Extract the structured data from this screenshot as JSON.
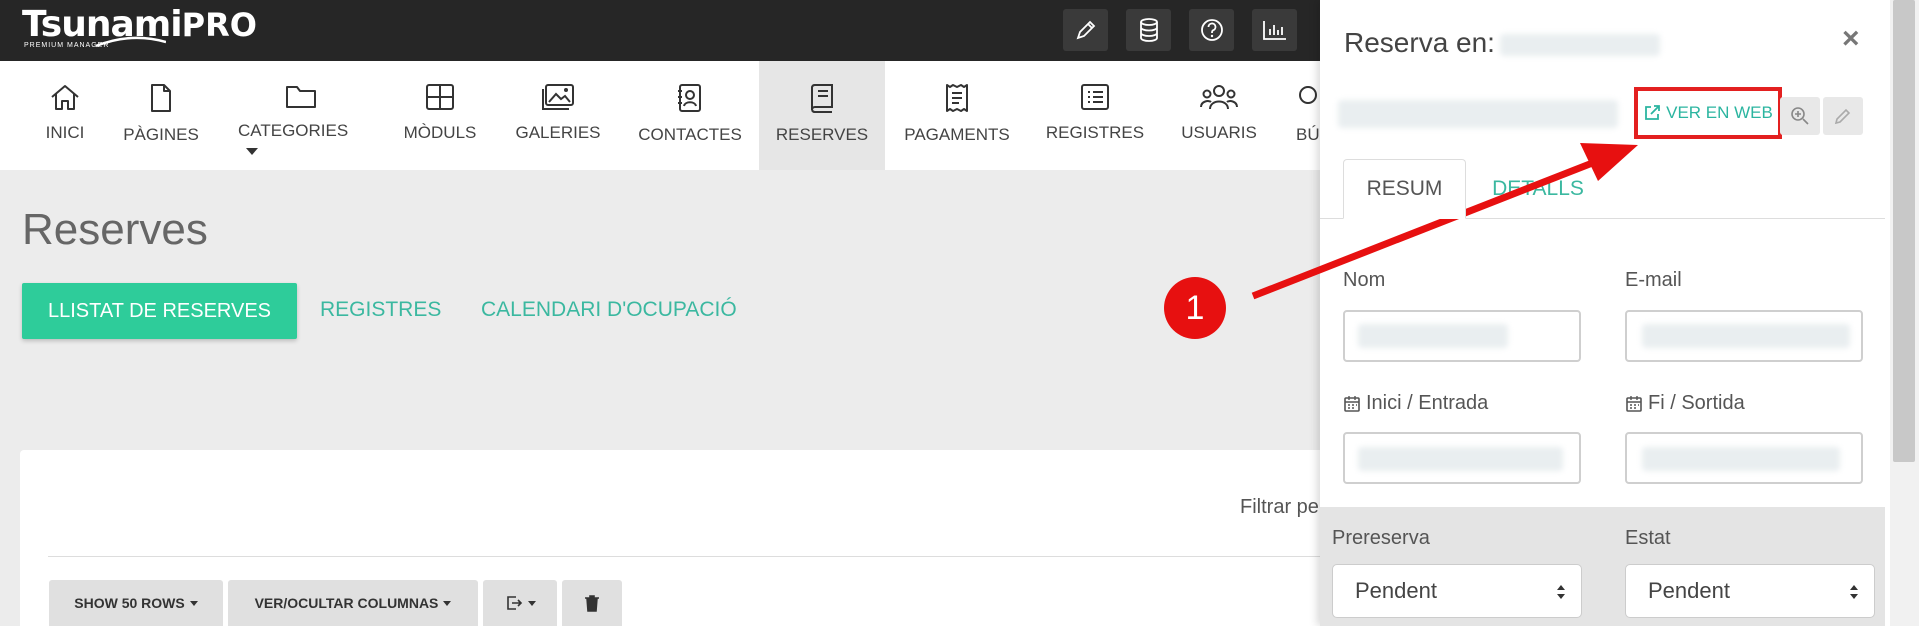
{
  "brand": {
    "name": "Tsunami",
    "suffix": "PRO",
    "tagline": "PREMIUM MANAGER"
  },
  "topbar": {
    "icons": [
      "pencil-icon",
      "database-icon",
      "help-icon",
      "chart-icon"
    ]
  },
  "nav": {
    "items": [
      {
        "label": "INICI",
        "icon": "home-icon"
      },
      {
        "label": "PÀGINES",
        "icon": "page-icon"
      },
      {
        "label": "CATEGORIES",
        "icon": "folder-icon"
      },
      {
        "label": "MÒDULS",
        "icon": "grid-icon"
      },
      {
        "label": "GALERIES",
        "icon": "gallery-icon"
      },
      {
        "label": "CONTACTES",
        "icon": "contacts-icon"
      },
      {
        "label": "RESERVES",
        "icon": "book-icon",
        "active": true
      },
      {
        "label": "PAGAMENTS",
        "icon": "receipt-icon"
      },
      {
        "label": "REGISTRES",
        "icon": "list-icon"
      },
      {
        "label": "USUARIS",
        "icon": "users-icon"
      },
      {
        "label": "BÚ",
        "icon": "search-icon"
      }
    ]
  },
  "page": {
    "title": "Reserves",
    "tabs": {
      "primary": "LLISTAT DE RESERVES",
      "registres": "REGISTRES",
      "calendari": "CALENDARI D'OCUPACIÓ"
    },
    "filter_label": "Filtrar pe",
    "toolbar": {
      "show_rows": "SHOW 50 ROWS",
      "columns": "VER/OCULTAR COLUMNAS"
    }
  },
  "panel": {
    "title": "Reserva en:",
    "close": "×",
    "ver_web": "VER EN WEB",
    "tabs": {
      "resum": "RESUM",
      "details": "DETALLS"
    },
    "fields": {
      "nom": "Nom",
      "email": "E-mail",
      "inici": "Inici / Entrada",
      "fi": "Fi / Sortida",
      "prereserva": "Prereserva",
      "estat": "Estat"
    },
    "selects": {
      "prereserva_value": "Pendent",
      "estat_value": "Pendent"
    }
  },
  "annotation": {
    "number": "1",
    "color": "#e71010"
  },
  "colors": {
    "accent": "#2ecc9a",
    "link": "#3bb8a0",
    "highlight": "#e32020"
  }
}
